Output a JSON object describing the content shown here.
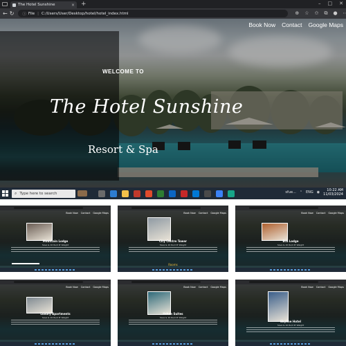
{
  "browser": {
    "tab_title": "The Hotel Sunshine",
    "tab_close": "×",
    "new_tab": "+",
    "url_label": "File",
    "url": "C:/Users/User/Desktop/hotel/hotel_index.html"
  },
  "page": {
    "nav": [
      "Book Now",
      "Contact",
      "Google Maps"
    ],
    "welcome": "WELCOME TO",
    "title": "The Hotel Sunshine",
    "subtitle": "Resort & Spa"
  },
  "taskbar": {
    "search_placeholder": "Type here to search",
    "tray_name": "sfue...",
    "lang": "ENG",
    "time": "10:22 AM",
    "date": "11/03/2024",
    "app_colors": [
      "#6b6b6b",
      "#2d7dd2",
      "#f3c04a",
      "#c0392b",
      "#e04b2b",
      "#2e7d32",
      "#0b66c2",
      "#c62828",
      "#0078d4",
      "#4a4a4a",
      "#3b82f6",
      "#17a589"
    ]
  },
  "thumbnails": [
    {
      "name": "Mountain Lodge",
      "sub": "Save & 10 Rs/d Pr Weight",
      "photo": "#6b5e55",
      "extra": ""
    },
    {
      "name": "City Centre Tower",
      "sub": "Save & 10 Rs/d Pr Weight",
      "photo": "#8f9aa3",
      "extra": "Rooms"
    },
    {
      "name": "Eco Lodge",
      "sub": "Save & 10 Rs/d Pr Weight",
      "photo": "#b0612f",
      "extra": ""
    },
    {
      "name": "Luxury Apartments",
      "sub": "Save & 10 Rs/d Pr Weight",
      "photo": "#7f8a92",
      "extra": ""
    },
    {
      "name": "Urban Suites",
      "sub": "Save & 10 Rs/d Pr Weight",
      "photo": "#2f6a7a",
      "extra": ""
    },
    {
      "name": "Skyline Hotel",
      "sub": "Save & 10 Rs/d Pr Weight",
      "photo": "#3b5f8a",
      "extra": ""
    }
  ]
}
